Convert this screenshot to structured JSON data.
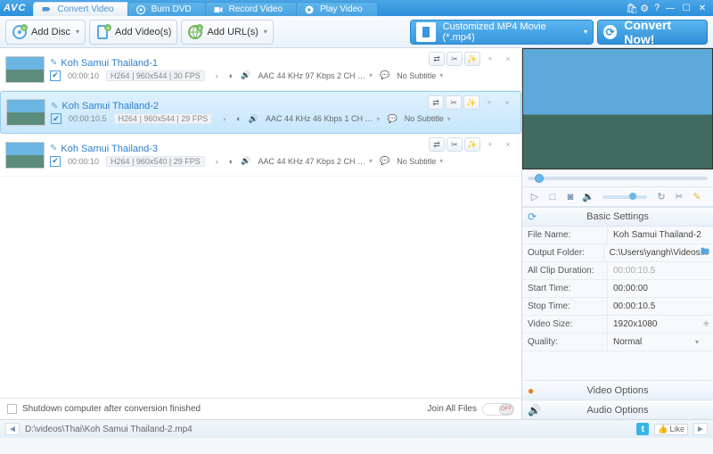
{
  "app": {
    "logo": "AVC"
  },
  "tabs": [
    {
      "label": "Convert Video",
      "active": true
    },
    {
      "label": "Burn DVD",
      "active": false
    },
    {
      "label": "Record Video",
      "active": false
    },
    {
      "label": "Play Video",
      "active": false
    }
  ],
  "toolbar": {
    "add_disc": "Add Disc",
    "add_videos": "Add Video(s)",
    "add_urls": "Add URL(s)",
    "profile": "Customized MP4 Movie (*.mp4)",
    "convert": "Convert Now!"
  },
  "files": [
    {
      "title": "Koh Samui Thailand-1",
      "duration": "00:00:10",
      "codec": "H264 | 960x544 | 30 FPS",
      "audio": "AAC 44 KHz 97 Kbps 2 CH …",
      "subtitle": "No Subtitle",
      "selected": false
    },
    {
      "title": "Koh Samui Thailand-2",
      "duration": "00:00:10.5",
      "codec": "H264 | 960x544 | 29 FPS",
      "audio": "AAC 44 KHz 46 Kbps 1 CH …",
      "subtitle": "No Subtitle",
      "selected": true
    },
    {
      "title": "Koh Samui Thailand-3",
      "duration": "00:00:10",
      "codec": "H264 | 960x540 | 29 FPS",
      "audio": "AAC 44 KHz 47 Kbps 2 CH …",
      "subtitle": "No Subtitle",
      "selected": false
    }
  ],
  "list_footer": {
    "shutdown": "Shutdown computer after conversion finished",
    "join": "Join All Files",
    "join_state": "OFF"
  },
  "settings": {
    "header": "Basic Settings",
    "file_name_k": "File Name:",
    "file_name_v": "Koh Samui Thailand-2",
    "output_k": "Output Folder:",
    "output_v": "C:\\Users\\yangh\\Videos...",
    "clip_k": "All Clip Duration:",
    "clip_v": "00:00:10.5",
    "start_k": "Start Time:",
    "start_v": "00:00:00",
    "stop_k": "Stop Time:",
    "stop_v": "00:00:10.5",
    "size_k": "Video Size:",
    "size_v": "1920x1080",
    "quality_k": "Quality:",
    "quality_v": "Normal",
    "video_options": "Video Options",
    "audio_options": "Audio Options"
  },
  "status": {
    "path": "D:\\videos\\Thai\\Koh Samui Thailand-2.mp4",
    "like": "Like"
  }
}
